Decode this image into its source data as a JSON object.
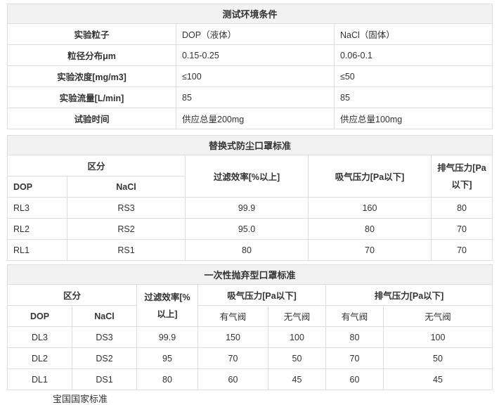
{
  "env_table": {
    "title": "测试环境条件",
    "rows": [
      {
        "label": "实验粒子",
        "dop": "DOP（液体）",
        "nacl": "NaCl（固体）"
      },
      {
        "label": "粒径分布μm",
        "dop": "0.15-0.25",
        "nacl": "0.06-0.1"
      },
      {
        "label": "实验浓度[mg/m3]",
        "dop": "≤100",
        "nacl": "≤50"
      },
      {
        "label": "实验流量[L/min]",
        "dop": "85",
        "nacl": "85"
      },
      {
        "label": "试验时间",
        "dop": "供应总量200mg",
        "nacl": "供应总量100mg"
      }
    ]
  },
  "replaceable_table": {
    "title": "替换式防尘口罩标准",
    "headers": {
      "category": "区分",
      "dop": "DOP",
      "nacl": "NaCl",
      "efficiency": "过滤效率[%以上]",
      "inhale": "吸气压力[Pa以下]",
      "exhale": "排气压力[Pa以下]"
    },
    "rows": [
      {
        "dop": "RL3",
        "nacl": "RS3",
        "efficiency": "99.9",
        "inhale": "160",
        "exhale": "80"
      },
      {
        "dop": "RL2",
        "nacl": "RS2",
        "efficiency": "95.0",
        "inhale": "80",
        "exhale": "70"
      },
      {
        "dop": "RL1",
        "nacl": "RS1",
        "efficiency": "80",
        "inhale": "70",
        "exhale": "70"
      }
    ]
  },
  "disposable_table": {
    "title": "一次性抛弃型口罩标准",
    "headers": {
      "category": "区分",
      "dop": "DOP",
      "nacl": "NaCl",
      "efficiency": "过滤效率[%以上]",
      "inhale": "吸气压力[Pa以下]",
      "exhale": "排气压力[Pa以下]",
      "with_valve": "有气阀",
      "without_valve": "无气阀"
    },
    "rows": [
      {
        "dop": "DL3",
        "nacl": "DS3",
        "efficiency": "99.9",
        "inhale_valve": "150",
        "inhale_novalve": "100",
        "exhale_valve": "80",
        "exhale_novalve": "100"
      },
      {
        "dop": "DL2",
        "nacl": "DS2",
        "efficiency": "95",
        "inhale_valve": "70",
        "inhale_novalve": "50",
        "exhale_valve": "70",
        "exhale_novalve": "50"
      },
      {
        "dop": "DL1",
        "nacl": "DS1",
        "efficiency": "80",
        "inhale_valve": "60",
        "inhale_novalve": "45",
        "exhale_valve": "60",
        "exhale_novalve": "45"
      }
    ]
  },
  "footer_fragment": "宝国国家标准"
}
